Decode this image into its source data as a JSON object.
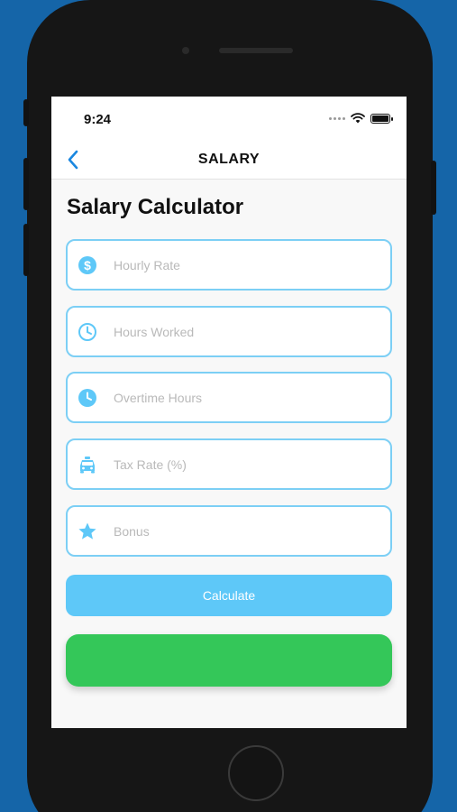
{
  "status_bar": {
    "time": "9:24"
  },
  "nav": {
    "title": "SALARY"
  },
  "page": {
    "title": "Salary Calculator"
  },
  "fields": [
    {
      "icon": "dollar-circle-icon",
      "placeholder": "Hourly Rate",
      "value": ""
    },
    {
      "icon": "clock-outline-icon",
      "placeholder": "Hours Worked",
      "value": ""
    },
    {
      "icon": "clock-filled-icon",
      "placeholder": "Overtime Hours",
      "value": ""
    },
    {
      "icon": "taxi-icon",
      "placeholder": "Tax Rate (%)",
      "value": ""
    },
    {
      "icon": "star-icon",
      "placeholder": "Bonus",
      "value": ""
    }
  ],
  "buttons": {
    "calculate": "Calculate"
  },
  "colors": {
    "accent": "#5ec8f8",
    "field_border": "#7ccff5",
    "result_green": "#34c759",
    "background": "#1565a8"
  }
}
